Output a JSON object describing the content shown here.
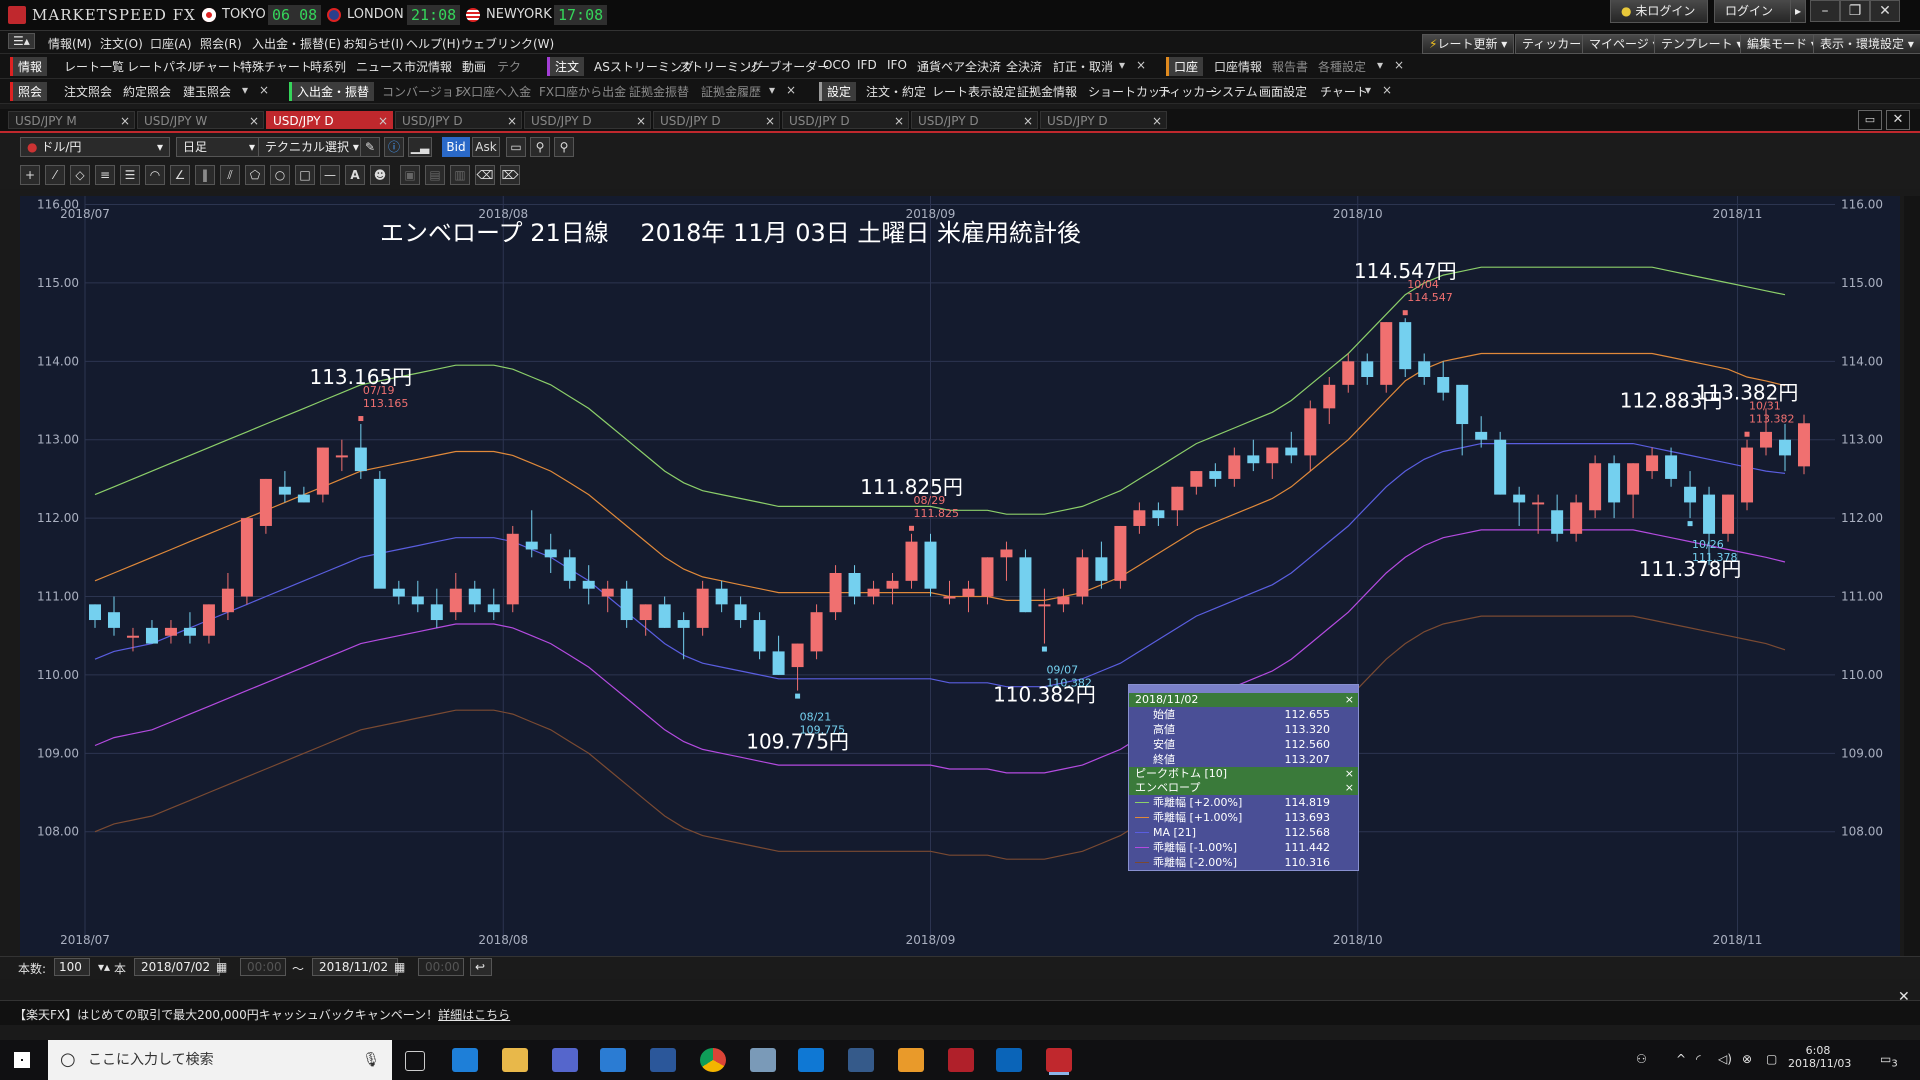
{
  "app": {
    "title": "MARKETSPEED FX"
  },
  "clocks": [
    {
      "city": "TOKYO",
      "time": "06 08"
    },
    {
      "city": "LONDON",
      "time": "21:08"
    },
    {
      "city": "NEWYORK",
      "time": "17:08"
    }
  ],
  "titlebar": {
    "status": "未ログイン",
    "login": "ログイン"
  },
  "menu": [
    "情報(M)",
    "注文(O)",
    "口座(A)",
    "照会(R)",
    "入出金・振替(E)",
    "お知らせ(I)",
    "ヘルプ(H)",
    "ウェブリンク(W)"
  ],
  "toolbar_right": [
    "レート更新",
    "ティッカー",
    "マイページ",
    "テンプレート",
    "編集モード",
    "表示・環境設定"
  ],
  "row2": {
    "sect1": "情報",
    "items1": [
      "レート一覧",
      "レートパネル",
      "チャート",
      "特殊チャート",
      "時系列",
      "ニュース",
      "市況情報",
      "動画",
      "テク"
    ],
    "sect2": "注文",
    "items2": [
      "ASストリーミング",
      "ストリーミング",
      "リーブオーダー",
      "OCO",
      "IFD",
      "IFO",
      "通貨ペア全決済",
      "全決済",
      "訂正・取消"
    ],
    "sect3": "口座",
    "items3": [
      "口座情報",
      "報告書",
      "各種設定"
    ]
  },
  "row3": {
    "sect1": "照会",
    "items1": [
      "注文照会",
      "約定照会",
      "建玉照会"
    ],
    "sect2": "入出金・振替",
    "items2": [
      "コンバージョン",
      "FX口座へ入金",
      "FX口座から出金",
      "証拠金振替",
      "証拠金履歴"
    ],
    "sect3": "設定",
    "items3": [
      "注文・約定",
      "レート表示設定",
      "証拠金情報",
      "ショートカット",
      "ティッカー",
      "システム",
      "画面設定",
      "チャート"
    ]
  },
  "tabs": [
    "USD/JPY M",
    "USD/JPY W",
    "USD/JPY D",
    "USD/JPY D",
    "USD/JPY D",
    "USD/JPY D",
    "USD/JPY D",
    "USD/JPY D",
    "USD/JPY D"
  ],
  "chart_toolbar": {
    "pair": "ドル/円",
    "period": "日足",
    "technical": "テクニカル選択",
    "bid": "Bid",
    "ask": "Ask"
  },
  "chart_data": {
    "type": "candlestick",
    "title": "エンベロープ 21日線　 2018年 11月 03日 土曜日 米雇用統計後",
    "x_labels": [
      "2018/07",
      "2018/08",
      "2018/09",
      "2018/10",
      "2018/11"
    ],
    "y_ticks": [
      "116.00",
      "115.00",
      "114.00",
      "113.00",
      "112.00",
      "111.00",
      "110.00",
      "109.00",
      "108.00"
    ],
    "ylim": [
      107.8,
      116.3
    ],
    "n_bars": 89,
    "up_color": "#f07070",
    "down_color": "#74d0ef",
    "callouts": [
      {
        "big": "113.165円",
        "date": "07/19",
        "value": "113.165",
        "i": 14
      },
      {
        "big": "109.775円",
        "date": "08/21",
        "value": "109.775",
        "i": 37
      },
      {
        "big": "111.825円",
        "date": "08/29",
        "value": "111.825",
        "i": 43
      },
      {
        "big": "110.382円",
        "date": "09/07",
        "value": "110.382",
        "i": 50
      },
      {
        "big": "114.547円",
        "date": "10/04",
        "value": "114.547",
        "i": 69
      },
      {
        "big": "112.883円",
        "date": "",
        "value": "",
        "i": 83
      },
      {
        "big": "111.378円",
        "date": "10/26",
        "value": "111.378",
        "i": 84
      },
      {
        "big": "113.382円",
        "date": "10/31",
        "value": "113.382",
        "i": 87
      }
    ],
    "candles": [
      [
        110.9,
        110.9,
        110.6,
        110.7
      ],
      [
        110.8,
        111.0,
        110.5,
        110.6
      ],
      [
        110.5,
        110.6,
        110.3,
        110.5
      ],
      [
        110.6,
        110.7,
        110.4,
        110.4
      ],
      [
        110.5,
        110.7,
        110.4,
        110.6
      ],
      [
        110.6,
        110.8,
        110.4,
        110.5
      ],
      [
        110.5,
        110.9,
        110.4,
        110.9
      ],
      [
        110.8,
        111.3,
        110.7,
        111.1
      ],
      [
        111.0,
        112.0,
        110.9,
        112.0
      ],
      [
        111.9,
        112.5,
        111.8,
        112.5
      ],
      [
        112.4,
        112.6,
        112.2,
        112.3
      ],
      [
        112.3,
        112.4,
        112.2,
        112.2
      ],
      [
        112.3,
        112.9,
        112.2,
        112.9
      ],
      [
        112.8,
        113.0,
        112.6,
        112.8
      ],
      [
        112.9,
        113.2,
        112.5,
        112.6
      ],
      [
        112.5,
        112.6,
        111.3,
        111.1
      ],
      [
        111.1,
        111.2,
        110.9,
        111.0
      ],
      [
        111.0,
        111.2,
        110.8,
        110.9
      ],
      [
        110.9,
        111.1,
        110.6,
        110.7
      ],
      [
        110.8,
        111.3,
        110.7,
        111.1
      ],
      [
        111.1,
        111.2,
        110.8,
        110.9
      ],
      [
        110.9,
        111.1,
        110.7,
        110.8
      ],
      [
        110.9,
        111.9,
        110.8,
        111.8
      ],
      [
        111.7,
        112.1,
        111.5,
        111.6
      ],
      [
        111.6,
        111.8,
        111.3,
        111.5
      ],
      [
        111.5,
        111.6,
        111.1,
        111.2
      ],
      [
        111.2,
        111.4,
        110.9,
        111.1
      ],
      [
        111.0,
        111.2,
        110.8,
        111.1
      ],
      [
        111.1,
        111.2,
        110.6,
        110.7
      ],
      [
        110.7,
        110.9,
        110.5,
        110.9
      ],
      [
        110.9,
        111.0,
        110.6,
        110.6
      ],
      [
        110.7,
        110.8,
        110.2,
        110.6
      ],
      [
        110.6,
        111.2,
        110.5,
        111.1
      ],
      [
        111.1,
        111.2,
        110.8,
        110.9
      ],
      [
        110.9,
        111.0,
        110.6,
        110.7
      ],
      [
        110.7,
        110.8,
        110.2,
        110.3
      ],
      [
        110.3,
        110.5,
        110.0,
        110.0
      ],
      [
        110.1,
        110.4,
        109.8,
        110.4
      ],
      [
        110.3,
        110.9,
        110.2,
        110.8
      ],
      [
        110.8,
        111.4,
        110.7,
        111.3
      ],
      [
        111.3,
        111.4,
        110.9,
        111.0
      ],
      [
        111.0,
        111.2,
        110.9,
        111.1
      ],
      [
        111.1,
        111.3,
        110.9,
        111.2
      ],
      [
        111.2,
        111.8,
        111.1,
        111.7
      ],
      [
        111.7,
        111.8,
        111.0,
        111.1
      ],
      [
        111.0,
        111.2,
        110.9,
        111.0
      ],
      [
        111.0,
        111.2,
        110.8,
        111.1
      ],
      [
        111.0,
        111.5,
        110.9,
        111.5
      ],
      [
        111.5,
        111.7,
        111.2,
        111.6
      ],
      [
        111.5,
        111.6,
        110.8,
        110.8
      ],
      [
        110.9,
        111.1,
        110.4,
        110.9
      ],
      [
        110.9,
        111.1,
        110.8,
        111.0
      ],
      [
        111.0,
        111.6,
        110.9,
        111.5
      ],
      [
        111.5,
        111.7,
        111.1,
        111.2
      ],
      [
        111.2,
        111.9,
        111.1,
        111.9
      ],
      [
        111.9,
        112.2,
        111.8,
        112.1
      ],
      [
        112.1,
        112.2,
        111.9,
        112.0
      ],
      [
        112.1,
        112.4,
        111.9,
        112.4
      ],
      [
        112.4,
        112.6,
        112.3,
        112.6
      ],
      [
        112.6,
        112.7,
        112.4,
        112.5
      ],
      [
        112.5,
        112.9,
        112.4,
        112.8
      ],
      [
        112.8,
        113.0,
        112.6,
        112.7
      ],
      [
        112.7,
        112.9,
        112.5,
        112.9
      ],
      [
        112.9,
        113.1,
        112.7,
        112.8
      ],
      [
        112.8,
        113.5,
        112.6,
        113.4
      ],
      [
        113.4,
        113.8,
        113.2,
        113.7
      ],
      [
        113.7,
        114.1,
        113.6,
        114.0
      ],
      [
        114.0,
        114.1,
        113.7,
        113.8
      ],
      [
        113.7,
        114.5,
        113.6,
        114.5
      ],
      [
        114.5,
        114.55,
        113.8,
        113.9
      ],
      [
        114.0,
        114.1,
        113.7,
        113.8
      ],
      [
        113.8,
        114.0,
        113.5,
        113.6
      ],
      [
        113.7,
        113.7,
        112.8,
        113.2
      ],
      [
        113.1,
        113.3,
        112.9,
        113.0
      ],
      [
        113.0,
        113.1,
        112.3,
        112.3
      ],
      [
        112.3,
        112.4,
        111.9,
        112.2
      ],
      [
        112.2,
        112.3,
        111.8,
        112.2
      ],
      [
        112.1,
        112.3,
        111.7,
        111.8
      ],
      [
        111.8,
        112.3,
        111.7,
        112.2
      ],
      [
        112.1,
        112.8,
        112.0,
        112.7
      ],
      [
        112.7,
        112.8,
        112.0,
        112.2
      ],
      [
        112.3,
        112.7,
        112.0,
        112.7
      ],
      [
        112.6,
        112.9,
        112.5,
        112.8
      ],
      [
        112.8,
        112.9,
        112.4,
        112.5
      ],
      [
        112.4,
        112.6,
        112.0,
        112.2
      ],
      [
        112.3,
        112.4,
        111.4,
        111.8
      ],
      [
        111.8,
        112.3,
        111.7,
        112.3
      ],
      [
        112.2,
        113.0,
        112.1,
        112.9
      ],
      [
        112.9,
        113.4,
        112.8,
        113.1
      ],
      [
        113.0,
        113.2,
        112.6,
        112.8
      ],
      [
        112.66,
        113.32,
        112.56,
        113.21
      ]
    ],
    "series": [
      {
        "name": "乖離幅 [+2.00%]",
        "color": "#8ccf6a",
        "values": [
          112.3,
          112.4,
          112.5,
          112.6,
          112.7,
          112.8,
          112.9,
          113.0,
          113.1,
          113.2,
          113.3,
          113.4,
          113.5,
          113.6,
          113.7,
          113.75,
          113.8,
          113.85,
          113.9,
          113.95,
          113.95,
          113.95,
          113.9,
          113.8,
          113.7,
          113.55,
          113.4,
          113.2,
          113.0,
          112.8,
          112.6,
          112.45,
          112.35,
          112.3,
          112.25,
          112.2,
          112.15,
          112.15,
          112.15,
          112.15,
          112.15,
          112.15,
          112.15,
          112.15,
          112.15,
          112.1,
          112.1,
          112.1,
          112.05,
          112.05,
          112.05,
          112.1,
          112.15,
          112.25,
          112.35,
          112.5,
          112.65,
          112.8,
          112.95,
          113.05,
          113.15,
          113.25,
          113.35,
          113.5,
          113.7,
          113.9,
          114.1,
          114.35,
          114.6,
          114.85,
          115.0,
          115.1,
          115.15,
          115.2,
          115.2,
          115.2,
          115.2,
          115.2,
          115.2,
          115.2,
          115.2,
          115.2,
          115.2,
          115.15,
          115.1,
          115.05,
          115.0,
          114.95,
          114.9,
          114.85
        ]
      },
      {
        "name": "乖離幅 [+1.00%]",
        "color": "#e0893a",
        "values": [
          111.2,
          111.3,
          111.4,
          111.5,
          111.6,
          111.7,
          111.8,
          111.9,
          112.0,
          112.1,
          112.2,
          112.3,
          112.4,
          112.5,
          112.6,
          112.65,
          112.7,
          112.75,
          112.8,
          112.85,
          112.85,
          112.85,
          112.8,
          112.7,
          112.6,
          112.45,
          112.3,
          112.1,
          111.9,
          111.7,
          111.5,
          111.35,
          111.25,
          111.2,
          111.15,
          111.1,
          111.05,
          111.05,
          111.05,
          111.05,
          111.05,
          111.05,
          111.05,
          111.05,
          111.05,
          111.0,
          111.0,
          111.0,
          110.95,
          110.95,
          110.95,
          111.0,
          111.05,
          111.15,
          111.25,
          111.4,
          111.55,
          111.7,
          111.85,
          111.95,
          112.05,
          112.15,
          112.25,
          112.4,
          112.6,
          112.8,
          113.0,
          113.25,
          113.5,
          113.75,
          113.9,
          114.0,
          114.05,
          114.1,
          114.1,
          114.1,
          114.1,
          114.1,
          114.1,
          114.1,
          114.1,
          114.1,
          114.1,
          114.05,
          114.0,
          113.95,
          113.9,
          113.8,
          113.75,
          113.69
        ]
      },
      {
        "name": "MA [21]",
        "color": "#5a5ee0",
        "values": [
          110.2,
          110.3,
          110.35,
          110.4,
          110.5,
          110.6,
          110.7,
          110.8,
          110.9,
          111.0,
          111.1,
          111.2,
          111.3,
          111.4,
          111.5,
          111.55,
          111.6,
          111.65,
          111.7,
          111.75,
          111.75,
          111.75,
          111.7,
          111.6,
          111.5,
          111.35,
          111.2,
          111.0,
          110.8,
          110.6,
          110.4,
          110.25,
          110.15,
          110.1,
          110.05,
          110.0,
          109.95,
          109.95,
          109.95,
          109.95,
          109.95,
          109.95,
          109.95,
          109.95,
          109.95,
          109.9,
          109.9,
          109.9,
          109.85,
          109.85,
          109.85,
          109.9,
          109.95,
          110.05,
          110.15,
          110.3,
          110.45,
          110.6,
          110.75,
          110.85,
          110.95,
          111.05,
          111.15,
          111.3,
          111.5,
          111.7,
          111.9,
          112.15,
          112.4,
          112.6,
          112.75,
          112.85,
          112.9,
          112.95,
          112.95,
          112.95,
          112.95,
          112.95,
          112.95,
          112.95,
          112.95,
          112.95,
          112.9,
          112.85,
          112.8,
          112.75,
          112.7,
          112.65,
          112.6,
          112.57
        ]
      },
      {
        "name": "乖離幅 [-1.00%]",
        "color": "#b44be0",
        "values": [
          109.1,
          109.2,
          109.25,
          109.3,
          109.4,
          109.5,
          109.6,
          109.7,
          109.8,
          109.9,
          110.0,
          110.1,
          110.2,
          110.3,
          110.4,
          110.45,
          110.5,
          110.55,
          110.6,
          110.65,
          110.65,
          110.65,
          110.6,
          110.5,
          110.4,
          110.25,
          110.1,
          109.9,
          109.7,
          109.5,
          109.3,
          109.15,
          109.05,
          109.0,
          108.95,
          108.9,
          108.85,
          108.85,
          108.85,
          108.85,
          108.85,
          108.85,
          108.85,
          108.85,
          108.85,
          108.8,
          108.8,
          108.8,
          108.75,
          108.75,
          108.75,
          108.8,
          108.85,
          108.95,
          109.05,
          109.2,
          109.35,
          109.5,
          109.65,
          109.75,
          109.85,
          109.95,
          110.05,
          110.2,
          110.4,
          110.6,
          110.8,
          111.05,
          111.3,
          111.5,
          111.65,
          111.75,
          111.8,
          111.85,
          111.85,
          111.85,
          111.85,
          111.85,
          111.85,
          111.85,
          111.85,
          111.85,
          111.8,
          111.75,
          111.7,
          111.65,
          111.6,
          111.55,
          111.5,
          111.44
        ]
      },
      {
        "name": "乖離幅 [-2.00%]",
        "color": "#7a4a32",
        "values": [
          108.0,
          108.1,
          108.15,
          108.2,
          108.3,
          108.4,
          108.5,
          108.6,
          108.7,
          108.8,
          108.9,
          109.0,
          109.1,
          109.2,
          109.3,
          109.35,
          109.4,
          109.45,
          109.5,
          109.55,
          109.55,
          109.55,
          109.5,
          109.4,
          109.3,
          109.15,
          109.0,
          108.8,
          108.6,
          108.4,
          108.2,
          108.05,
          107.95,
          107.9,
          107.85,
          107.8,
          107.75,
          107.75,
          107.75,
          107.75,
          107.75,
          107.75,
          107.75,
          107.75,
          107.75,
          107.7,
          107.7,
          107.7,
          107.65,
          107.65,
          107.65,
          107.7,
          107.75,
          107.85,
          107.95,
          108.1,
          108.25,
          108.4,
          108.55,
          108.65,
          108.75,
          108.85,
          108.95,
          109.1,
          109.3,
          109.5,
          109.7,
          109.95,
          110.2,
          110.4,
          110.55,
          110.65,
          110.7,
          110.75,
          110.75,
          110.75,
          110.75,
          110.75,
          110.75,
          110.75,
          110.75,
          110.75,
          110.7,
          110.65,
          110.6,
          110.55,
          110.5,
          110.45,
          110.4,
          110.32
        ]
      }
    ]
  },
  "info_panel": {
    "date": "2018/11/02",
    "ohlc": [
      {
        "label": "始値",
        "value": "112.655"
      },
      {
        "label": "高値",
        "value": "113.320"
      },
      {
        "label": "安値",
        "value": "112.560"
      },
      {
        "label": "終値",
        "value": "113.207"
      }
    ],
    "peak_bottom": "ピークボトム [10]",
    "envelope": "エンベロープ",
    "lines": [
      {
        "label": "乖離幅 [+2.00%]",
        "value": "114.819",
        "color": "#8ccf6a"
      },
      {
        "label": "乖離幅 [+1.00%]",
        "value": "113.693",
        "color": "#e0893a"
      },
      {
        "label": "MA [21]",
        "value": "112.568",
        "color": "#5a5ee0"
      },
      {
        "label": "乖離幅 [-1.00%]",
        "value": "111.442",
        "color": "#b44be0"
      },
      {
        "label": "乖離幅 [-2.00%]",
        "value": "110.316",
        "color": "#7a4a32"
      }
    ]
  },
  "range_bar": {
    "count_label": "本数:",
    "count": "100",
    "unit": "本",
    "from": "2018/07/02",
    "from_time": "00:00",
    "sep": "〜",
    "to": "2018/11/02",
    "to_time": "00:00"
  },
  "ad": {
    "text": "【楽天FX】はじめての取引で最大200,000円キャッシュバックキャンペーン！",
    "link": "詳細はこちら"
  },
  "taskbar": {
    "search": "ここに入力して検索",
    "time": "6:08",
    "date": "2018/11/03",
    "notif": "3"
  }
}
